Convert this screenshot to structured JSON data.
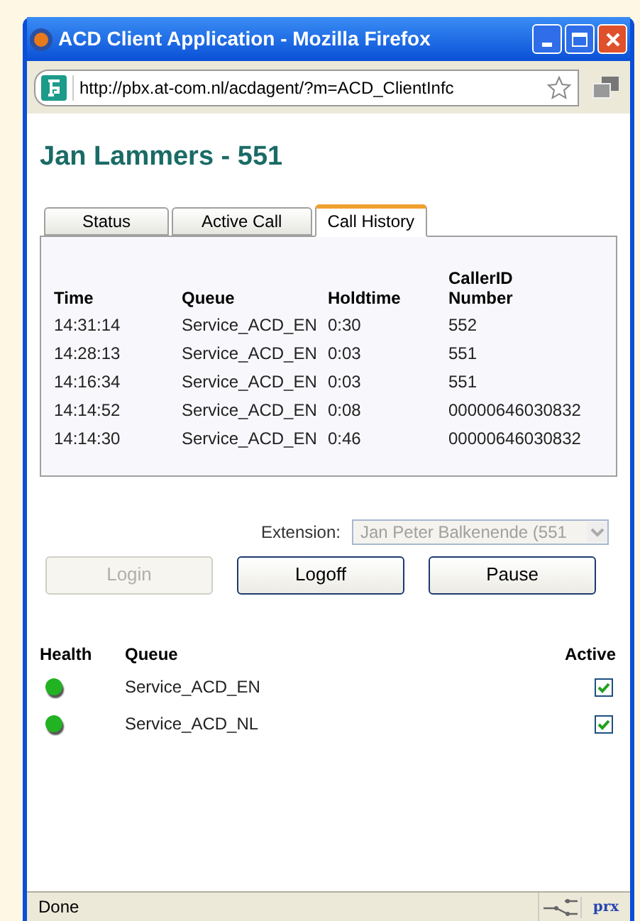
{
  "window": {
    "title": "ACD Client Application - Mozilla Firefox"
  },
  "address_bar": {
    "url": "http://pbx.at-com.nl/acdagent/?m=ACD_ClientInfc"
  },
  "heading": "Jan Lammers - 551",
  "tabs": [
    {
      "label": "Status",
      "selected": false
    },
    {
      "label": "Active Call",
      "selected": false
    },
    {
      "label": "Call History",
      "selected": true
    }
  ],
  "call_history": {
    "columns": [
      "Time",
      "Queue",
      "Holdtime",
      "CallerID Number"
    ],
    "rows": [
      [
        "14:31:14",
        "Service_ACD_EN",
        "0:30",
        "552"
      ],
      [
        "14:28:13",
        "Service_ACD_EN",
        "0:03",
        "551"
      ],
      [
        "14:16:34",
        "Service_ACD_EN",
        "0:03",
        "551"
      ],
      [
        "14:14:52",
        "Service_ACD_EN",
        "0:08",
        "00000646030832"
      ],
      [
        "14:14:30",
        "Service_ACD_EN",
        "0:46",
        "00000646030832"
      ]
    ]
  },
  "extension": {
    "label": "Extension:",
    "value": "Jan Peter Balkenende (551",
    "disabled": true
  },
  "buttons": [
    {
      "label": "Login",
      "disabled": true
    },
    {
      "label": "Logoff",
      "disabled": false
    },
    {
      "label": "Pause",
      "disabled": false
    }
  ],
  "queues": {
    "columns": [
      "Health",
      "Queue",
      "Active"
    ],
    "rows": [
      {
        "name": "Service_ACD_EN",
        "color": "#22b322",
        "active": true
      },
      {
        "name": "Service_ACD_NL",
        "color": "#22b322",
        "active": true
      }
    ]
  },
  "status_bar": {
    "text": "Done",
    "badge": "prx"
  }
}
